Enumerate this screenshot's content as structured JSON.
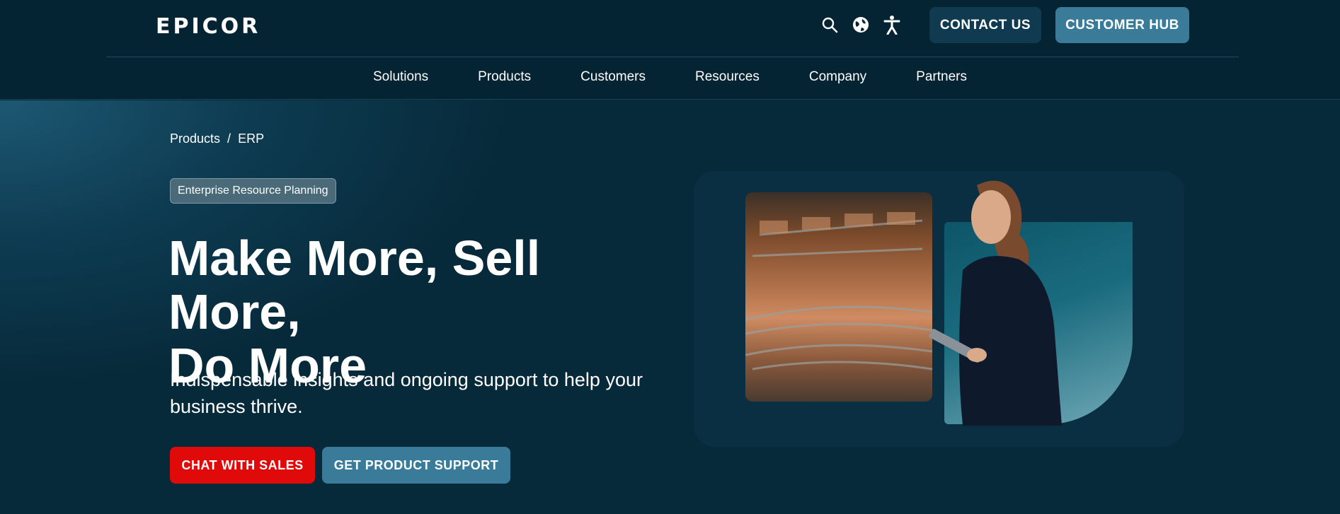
{
  "header": {
    "logo": "epicor",
    "icons": [
      "search-icon",
      "globe-icon",
      "accessibility-icon"
    ],
    "contact_label": "CONTACT US",
    "hub_label": "CUSTOMER HUB"
  },
  "nav": {
    "items": [
      {
        "label": "Solutions"
      },
      {
        "label": "Products"
      },
      {
        "label": "Customers"
      },
      {
        "label": "Resources"
      },
      {
        "label": "Company"
      },
      {
        "label": "Partners"
      }
    ]
  },
  "hero": {
    "breadcrumb": {
      "first": "Products",
      "separator": "/",
      "second": "ERP"
    },
    "badge": "Enterprise Resource Planning",
    "title_line1": "Make More, Sell More,",
    "title_line2": "Do More",
    "subtitle_line1": "Indispensable insights and ongoing support to help your",
    "subtitle_line2": "business thrive.",
    "chat_label": "CHAT WITH SALES",
    "support_label": "GET PRODUCT SUPPORT"
  },
  "colors": {
    "background": "#072a3a",
    "primary_button": "#e10a0a",
    "secondary_button": "#3a7b99",
    "header": "#052433"
  }
}
